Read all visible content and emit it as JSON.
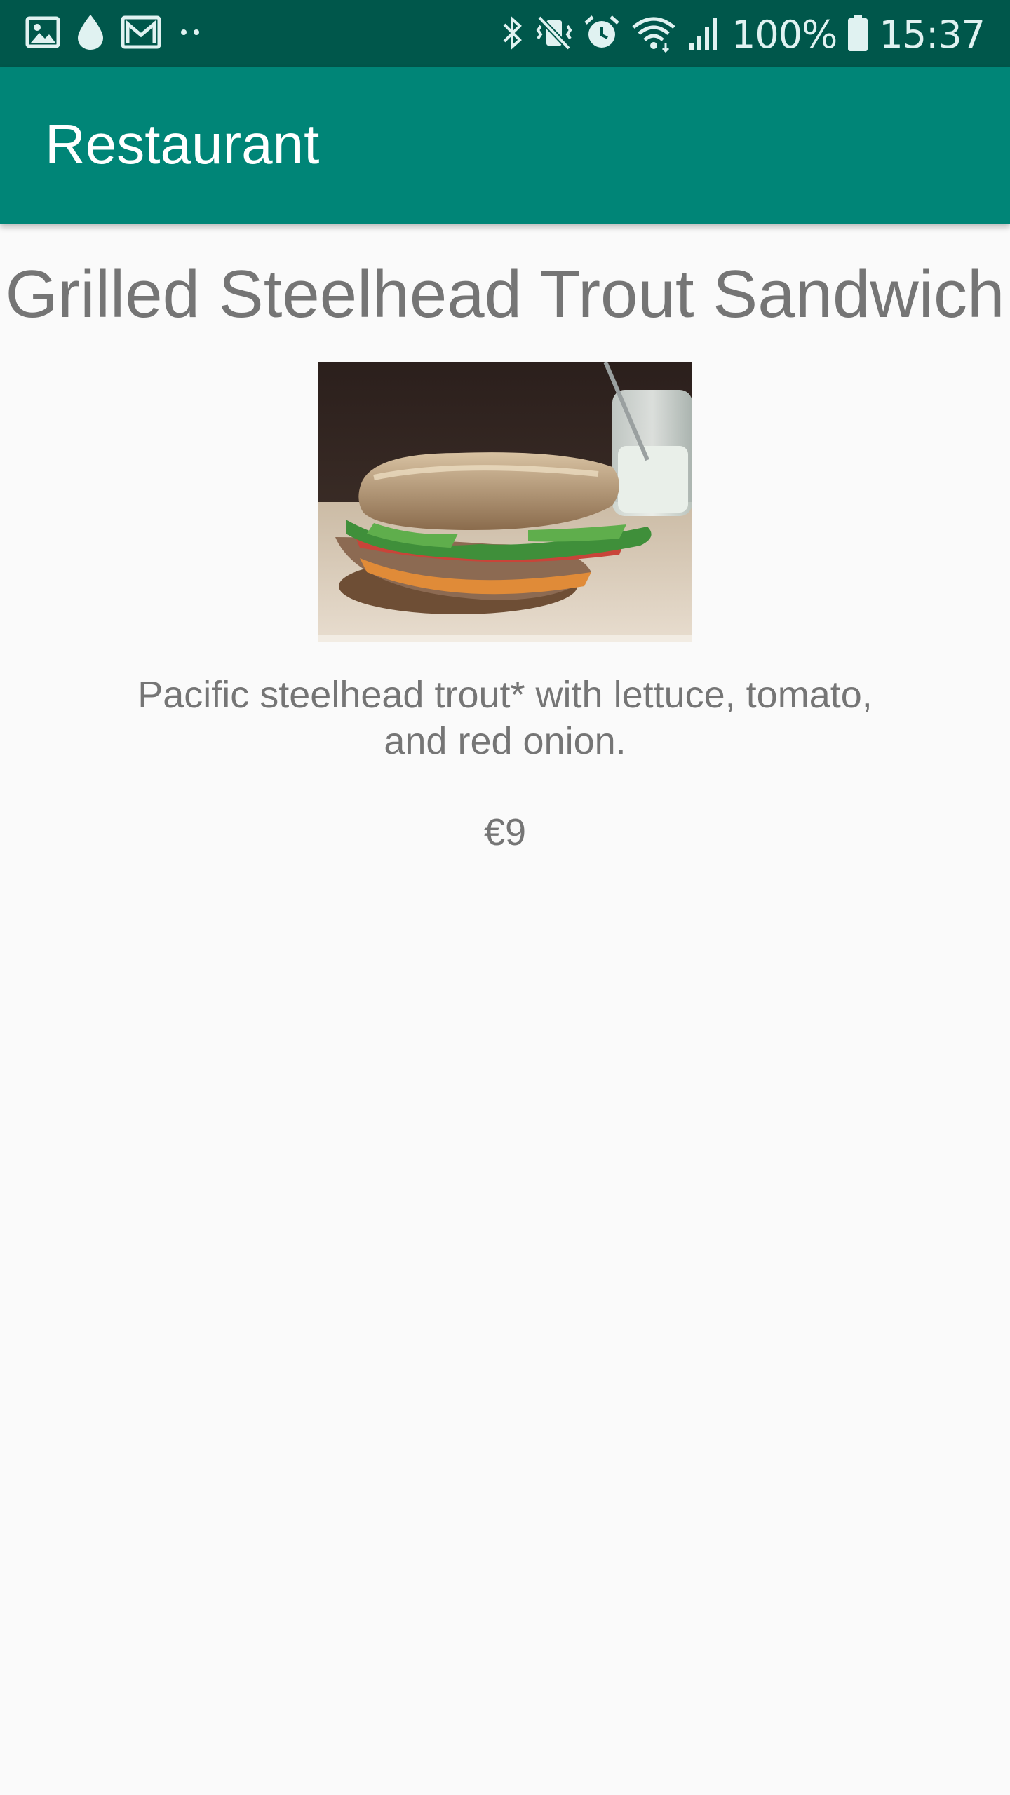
{
  "status_bar": {
    "left_icons": [
      "gallery-icon",
      "drop-icon",
      "gmail-icon",
      "more-dots-icon"
    ],
    "right_icons": [
      "bluetooth-icon",
      "vibrate-mute-icon",
      "alarm-icon",
      "wifi-icon",
      "signal-icon",
      "battery-icon"
    ],
    "battery_percent": "100%",
    "time": "15:37"
  },
  "app_bar": {
    "title": "Restaurant"
  },
  "item": {
    "name": "Grilled Steelhead Trout Sandwich",
    "image_icon": "sandwich-photo",
    "description": "Pacific steelhead trout* with lettuce, tomato, and red onion.",
    "price": "€9"
  },
  "colors": {
    "status_bar": "#00574B",
    "app_bar": "#008577",
    "background": "#FAFAFA",
    "text": "#757575"
  }
}
